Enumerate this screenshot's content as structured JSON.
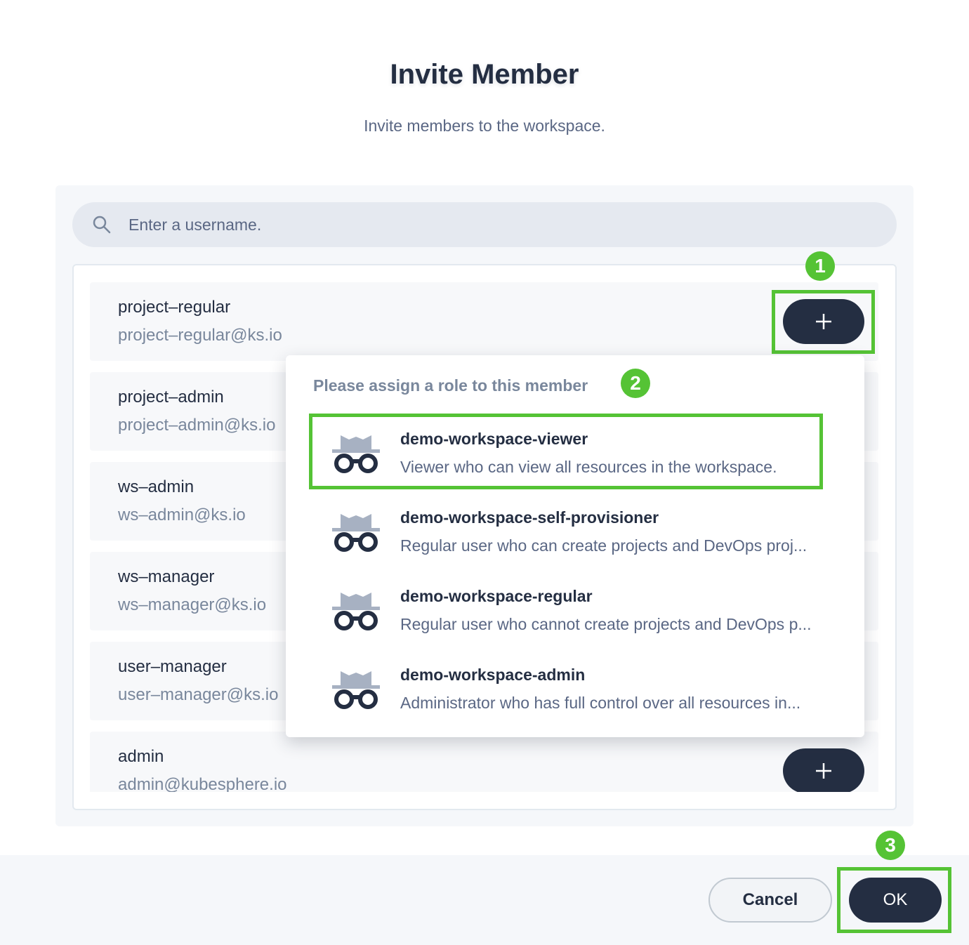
{
  "dialog": {
    "title": "Invite Member",
    "subtitle": "Invite members to the workspace."
  },
  "search": {
    "placeholder": "Enter a username.",
    "icon": "search-icon"
  },
  "users": [
    {
      "name": "project–regular",
      "email": "project–regular@ks.io"
    },
    {
      "name": "project–admin",
      "email": "project–admin@ks.io"
    },
    {
      "name": "ws–admin",
      "email": "ws–admin@ks.io"
    },
    {
      "name": "ws–manager",
      "email": "ws–manager@ks.io"
    },
    {
      "name": "user–manager",
      "email": "user–manager@ks.io"
    },
    {
      "name": "admin",
      "email": "admin@kubesphere.io"
    }
  ],
  "role_dropdown": {
    "title": "Please assign a role to this member",
    "roles": [
      {
        "name": "demo-workspace-viewer",
        "description": "Viewer who can view all resources in the workspace.",
        "icon": "role-icon"
      },
      {
        "name": "demo-workspace-self-provisioner",
        "description": "Regular user who can create projects and DevOps proj...",
        "icon": "role-icon"
      },
      {
        "name": "demo-workspace-regular",
        "description": "Regular user who cannot create projects and DevOps p...",
        "icon": "role-icon"
      },
      {
        "name": "demo-workspace-admin",
        "description": "Administrator who has full control over all resources in...",
        "icon": "role-icon"
      }
    ]
  },
  "steps": [
    "1",
    "2",
    "3"
  ],
  "footer": {
    "cancel_label": "Cancel",
    "ok_label": "OK"
  },
  "colors": {
    "primary": "#242e42",
    "highlight": "#55c335",
    "muted_text": "#79879c",
    "panel_bg": "#f5f7fa"
  }
}
